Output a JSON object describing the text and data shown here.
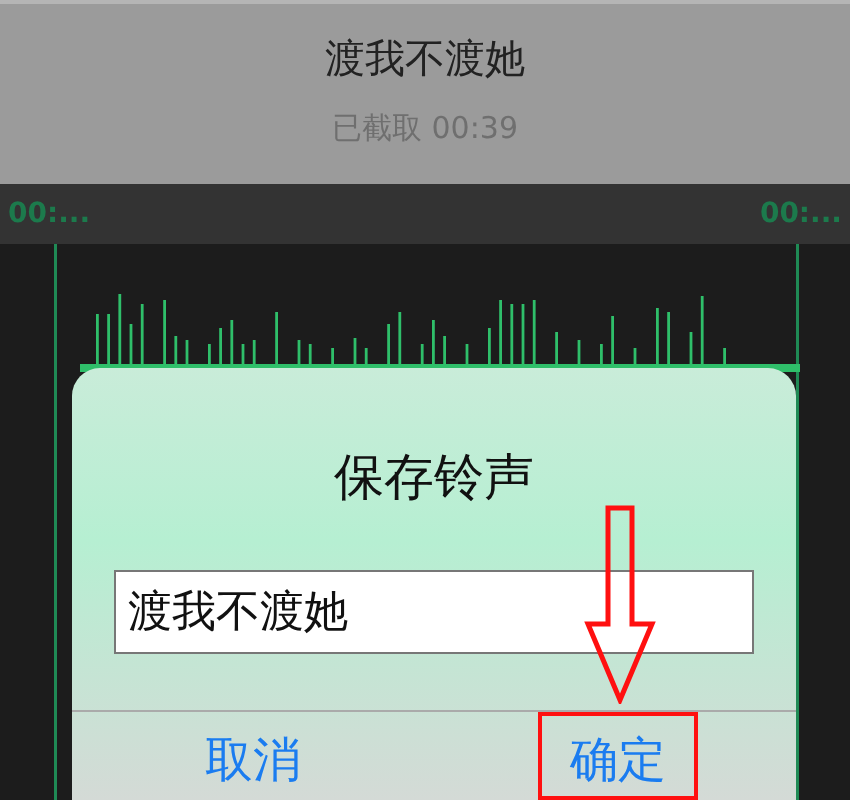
{
  "header": {
    "title": "渡我不渡她",
    "subtitle": "已截取 00:39"
  },
  "timeline": {
    "start_label": "00:...",
    "end_label": "00:..."
  },
  "dialog": {
    "title": "保存铃声",
    "field_value": "渡我不渡她",
    "buttons": [
      {
        "label": "取消",
        "highlighted": false
      },
      {
        "label": "确定",
        "highlighted": true
      }
    ]
  }
}
